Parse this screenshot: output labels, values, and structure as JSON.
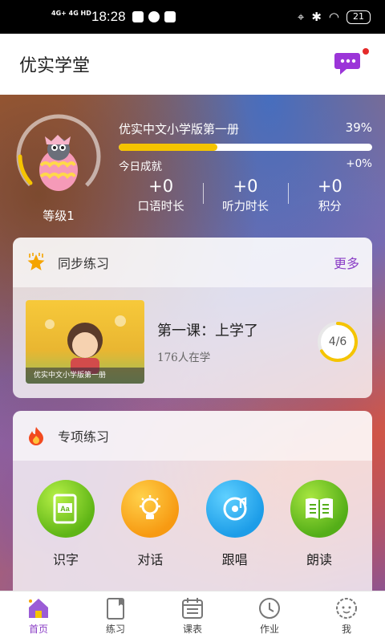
{
  "status_bar": {
    "network_1": "4G+",
    "network_2": "4G HD",
    "time": "18:28",
    "battery": "21"
  },
  "header": {
    "title": "优实学堂"
  },
  "profile": {
    "level": "等级1"
  },
  "book": {
    "title": "优实中文小学版第一册",
    "progress_text": "39%",
    "progress": 0.39,
    "today_label": "今日成就",
    "today_delta": "+0%",
    "stats": [
      {
        "value": "+0",
        "label": "口语时长"
      },
      {
        "value": "+0",
        "label": "听力时长"
      },
      {
        "value": "+0",
        "label": "积分"
      }
    ]
  },
  "sync_practice": {
    "title": "同步练习",
    "more": "更多",
    "lesson": {
      "thumbnail_caption": "优实中文小学版第一册",
      "name": "第一课：上学了",
      "learners": "176人在学",
      "progress_text": "4/6",
      "progress": 0.667
    }
  },
  "special_practice": {
    "title": "专项练习",
    "items": [
      {
        "label": "识字",
        "icon": "book-aa-icon"
      },
      {
        "label": "对话",
        "icon": "lightbulb-icon"
      },
      {
        "label": "跟唱",
        "icon": "music-disc-icon"
      },
      {
        "label": "朗读",
        "icon": "open-book-icon"
      }
    ]
  },
  "tabbar": {
    "items": [
      {
        "label": "首页",
        "icon": "home-icon",
        "active": true
      },
      {
        "label": "练习",
        "icon": "notebook-icon"
      },
      {
        "label": "课表",
        "icon": "schedule-icon"
      },
      {
        "label": "作业",
        "icon": "clock-icon"
      },
      {
        "label": "我",
        "icon": "profile-face-icon"
      }
    ]
  },
  "colors": {
    "accent": "#8b3ec6",
    "progress": "#f5c400",
    "badge": "#e52a2a"
  }
}
